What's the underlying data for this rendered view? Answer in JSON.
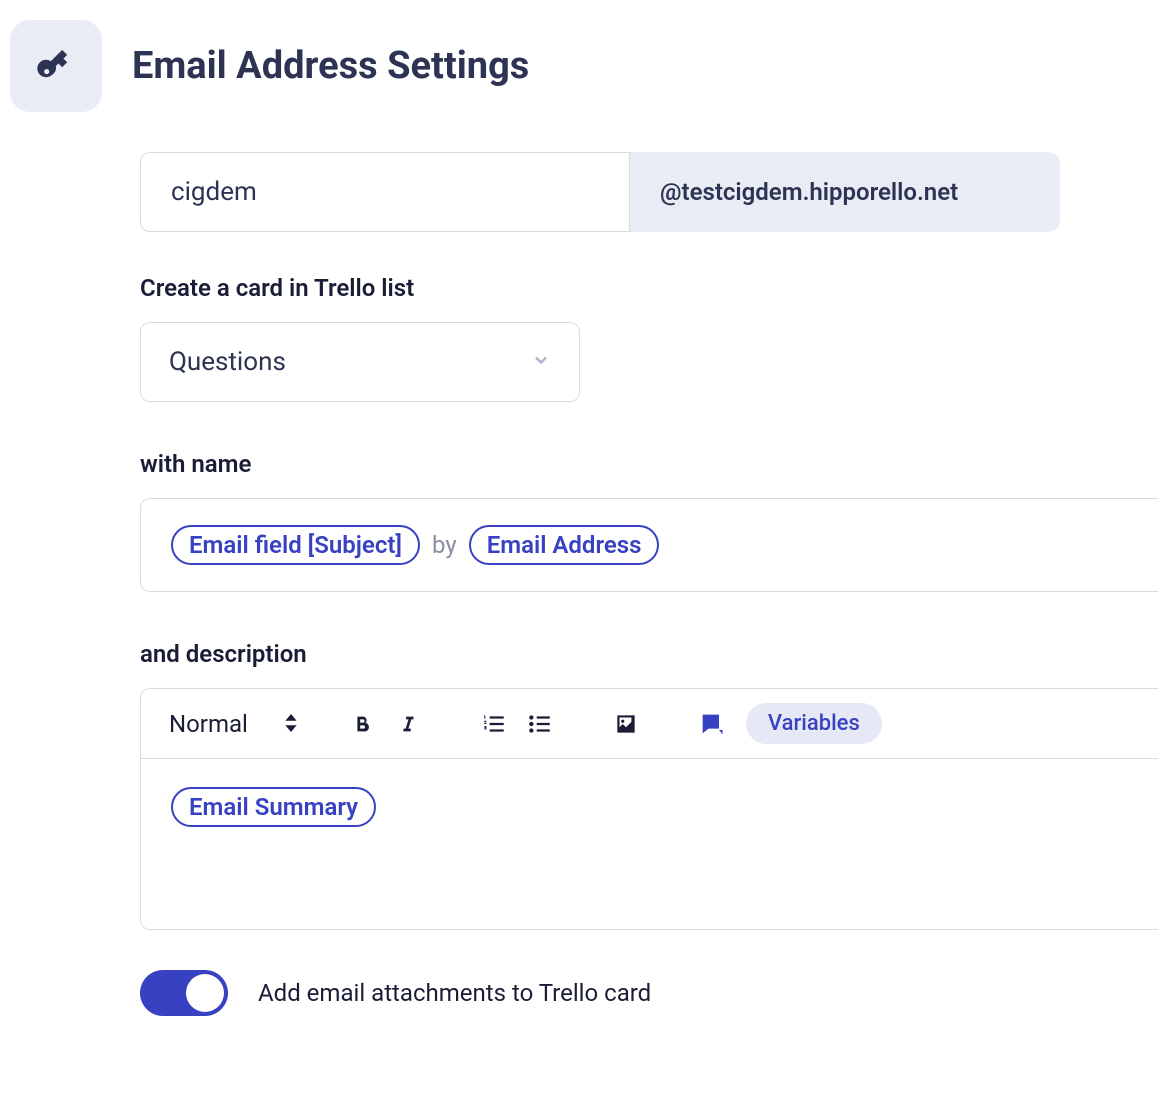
{
  "page": {
    "title": "Email Address Settings"
  },
  "email": {
    "value": "cigdem",
    "domain": "@testcigdem.hipporello.net"
  },
  "listSelect": {
    "label": "Create a card in Trello list",
    "selected": "Questions"
  },
  "nameField": {
    "label": "with name",
    "chip1": "Email field [Subject]",
    "joiner": "by",
    "chip2": "Email Address"
  },
  "descField": {
    "label": "and description",
    "format": "Normal",
    "variablesLabel": "Variables",
    "chip": "Email Summary"
  },
  "toggle": {
    "label": "Add email attachments to Trello card"
  }
}
